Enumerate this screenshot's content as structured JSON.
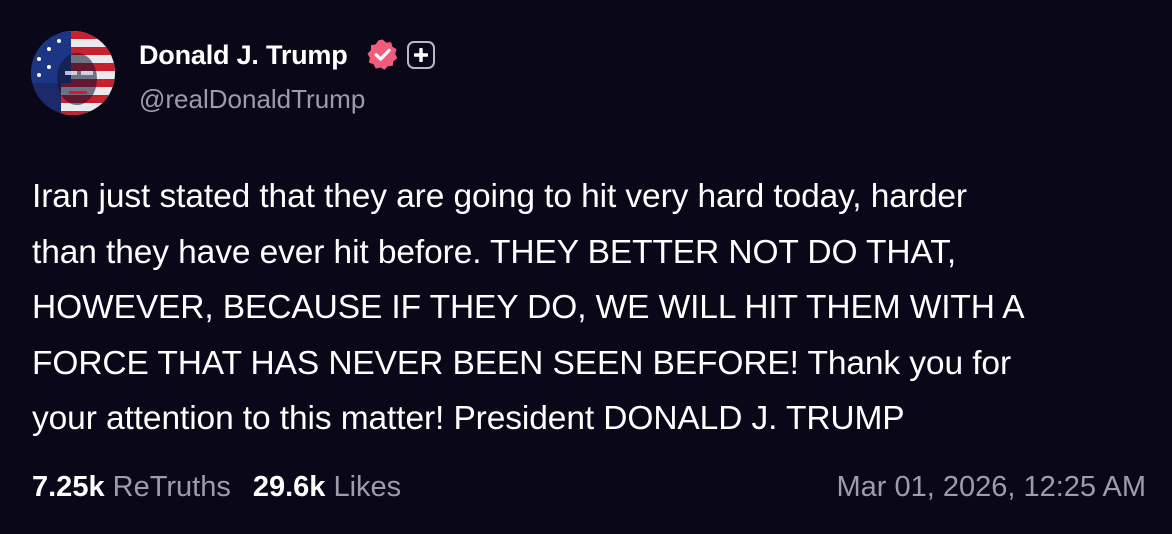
{
  "post": {
    "author": {
      "display_name": "Donald J. Trump",
      "handle": "@realDonaldTrump",
      "avatar_icon": "flag-portrait-avatar",
      "verified_icon": "verified-badge-icon",
      "plus_icon": "plus-icon"
    },
    "text": "Iran just stated that they are going to hit very hard today, harder\nthan they have ever hit before. THEY BETTER NOT DO THAT,\nHOWEVER, BECAUSE IF THEY DO, WE WILL HIT THEM WITH A\nFORCE THAT HAS NEVER BEEN SEEN BEFORE! Thank you for\nyour attention to this matter! President DONALD J. TRUMP",
    "stats": {
      "retruths_count": "7.25k",
      "retruths_label": "ReTruths",
      "likes_count": "29.6k",
      "likes_label": "Likes"
    },
    "timestamp": "Mar 01, 2026, 12:25 AM"
  },
  "colors": {
    "background": "#0a0818",
    "text_primary": "#ffffff",
    "text_secondary": "#9d9cad",
    "verified_badge": "#f25c7c"
  }
}
